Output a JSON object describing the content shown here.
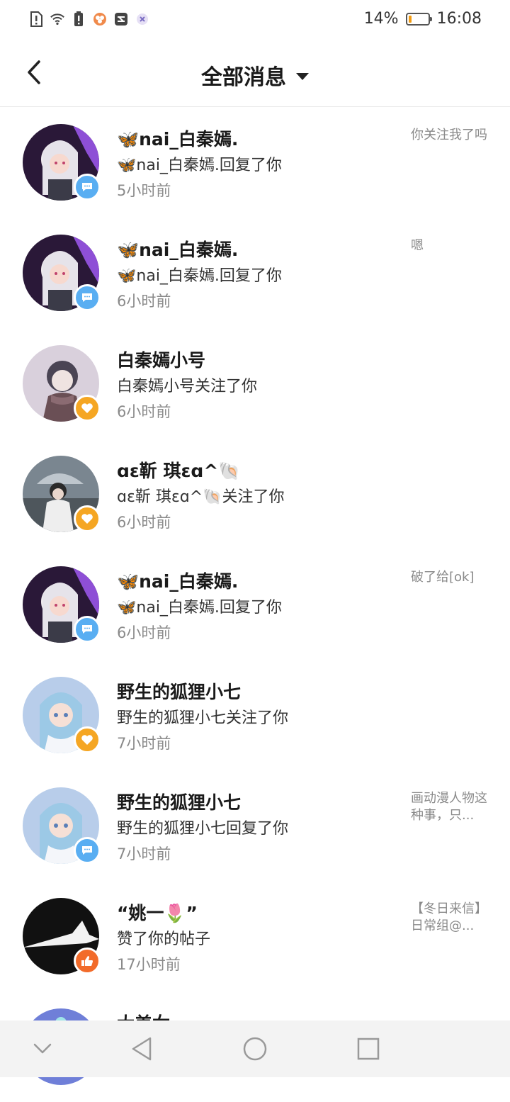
{
  "status_bar": {
    "battery_text": "14%",
    "battery_level": 0.14,
    "time": "16:08",
    "icons": [
      "sim-alert-icon",
      "wifi-icon",
      "battery-alert-icon",
      "app-notify-icon",
      "app-notify-icon-2",
      "app-notify-icon-3"
    ]
  },
  "header": {
    "title": "全部消息"
  },
  "messages": [
    {
      "name": "🦋nai_白秦嫣.",
      "action": "🦋nai_白秦嫣.回复了你",
      "time": "5小时前",
      "preview": "你关注我了吗",
      "badge": "comment"
    },
    {
      "name": "🦋nai_白秦嫣.",
      "action": "🦋nai_白秦嫣.回复了你",
      "time": "6小时前",
      "preview": "嗯",
      "badge": "comment"
    },
    {
      "name": "白秦嫣小号",
      "action": "白秦嫣小号关注了你",
      "time": "6小时前",
      "preview": "",
      "badge": "like"
    },
    {
      "name": "ɑɛ靳 琪ɛɑ^🐚",
      "action": "ɑɛ靳 琪ɛɑ^🐚关注了你",
      "time": "6小时前",
      "preview": "",
      "badge": "like"
    },
    {
      "name": "🦋nai_白秦嫣.",
      "action": "🦋nai_白秦嫣.回复了你",
      "time": "6小时前",
      "preview": "破了给[ok]",
      "badge": "comment"
    },
    {
      "name": "野生的狐狸小七",
      "action": "野生的狐狸小七关注了你",
      "time": "7小时前",
      "preview": "",
      "badge": "like"
    },
    {
      "name": "野生的狐狸小七",
      "action": "野生的狐狸小七回复了你",
      "time": "7小时前",
      "preview": "画动漫人物这种事，只...",
      "badge": "comment"
    },
    {
      "name": "“姚一🌷”",
      "action": "赞了你的帖子",
      "time": "17小时前",
      "preview": "【冬日来信】日常组@...",
      "badge": "thumb"
    },
    {
      "name": "大美女",
      "action": "",
      "time": "",
      "preview": "",
      "badge": ""
    }
  ],
  "colors": {
    "comment_badge": "#59aef2",
    "like_badge": "#f5a623",
    "thumb_badge": "#f26b2a",
    "battery_fill": "#f39c12"
  }
}
